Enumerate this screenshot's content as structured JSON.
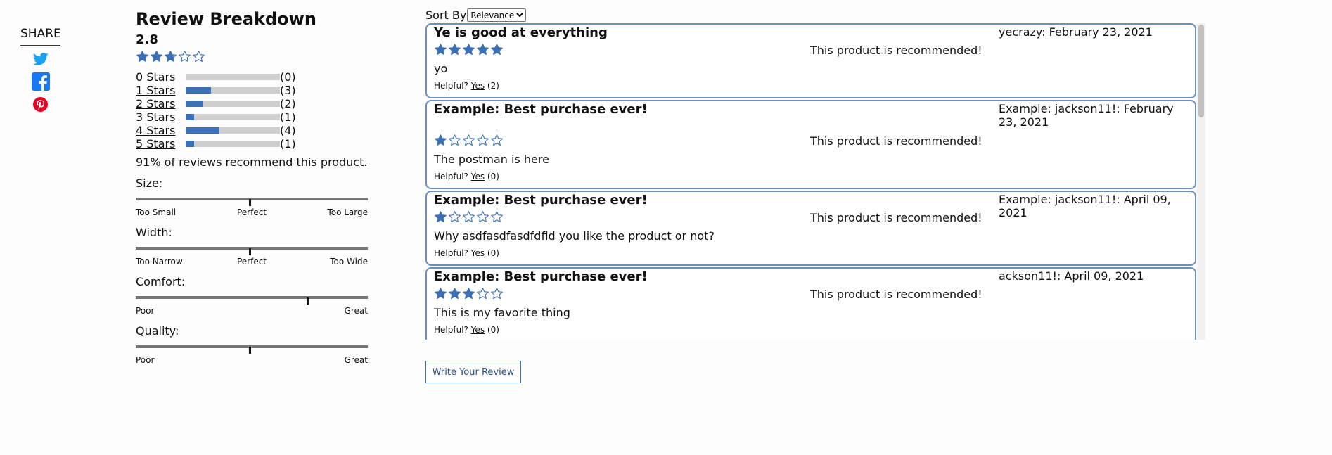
{
  "share": {
    "label": "SHARE",
    "icons": [
      "twitter-icon",
      "facebook-icon",
      "pinterest-icon"
    ],
    "colors": {
      "twitter": "#1da1f2",
      "facebook": "#1877f2",
      "pinterest": "#e60023"
    }
  },
  "breakdown": {
    "title": "Review Breakdown",
    "average": "2.8",
    "average_rating": 2.8,
    "distribution": [
      {
        "label": "0 Stars",
        "count": "(0)",
        "fraction": 0.0
      },
      {
        "label": "1 Stars",
        "count": "(3)",
        "fraction": 0.27
      },
      {
        "label": "2 Stars",
        "count": "(2)",
        "fraction": 0.18
      },
      {
        "label": "3 Stars",
        "count": "(1)",
        "fraction": 0.09
      },
      {
        "label": "4 Stars",
        "count": "(4)",
        "fraction": 0.36
      },
      {
        "label": "5 Stars",
        "count": "(1)",
        "fraction": 0.09
      }
    ],
    "recommend_text": "91% of reviews recommend this product.",
    "characteristics": [
      {
        "name": "Size:",
        "value": 0.49,
        "labels": {
          "left": "Too Small",
          "middle": "Perfect",
          "right": "Too Large"
        }
      },
      {
        "name": "Width:",
        "value": 0.49,
        "labels": {
          "left": "Too Narrow",
          "middle": "Perfect",
          "right": "Too Wide"
        }
      },
      {
        "name": "Comfort:",
        "value": 0.74,
        "labels": {
          "left": "Poor",
          "right": "Great"
        }
      },
      {
        "name": "Quality:",
        "value": 0.49,
        "labels": {
          "left": "Poor",
          "right": "Great"
        }
      }
    ]
  },
  "sort": {
    "label": "Sort By",
    "selected": "Relevance"
  },
  "reviews": [
    {
      "title": "Ye is good at everything",
      "author": "yecrazy: February 23, 2021",
      "rating": 5,
      "recommend": "This product is recommended!",
      "body": "yo",
      "helpful_label": "Helpful?",
      "yes_label": "Yes",
      "helpful_count": "(2)"
    },
    {
      "title": "Example: Best purchase ever!",
      "author": "Example: jackson11!: February 23, 2021",
      "rating": 1,
      "recommend": "This product is recommended!",
      "body": "The postman is here",
      "helpful_label": "Helpful?",
      "yes_label": "Yes",
      "helpful_count": "(0)"
    },
    {
      "title": "Example: Best purchase ever!",
      "author": "Example: jackson11!: April 09, 2021",
      "rating": 1,
      "recommend": "This product is recommended!",
      "body": "Why asdfasdfasdfdfid you like the product or not?",
      "helpful_label": "Helpful?",
      "yes_label": "Yes",
      "helpful_count": "(0)"
    },
    {
      "title": "Example: Best purchase ever!",
      "author": "ackson11!: April 09, 2021",
      "rating": 3,
      "recommend": "This product is recommended!",
      "body": "This is my favorite thing",
      "helpful_label": "Helpful?",
      "yes_label": "Yes",
      "helpful_count": "(0)"
    }
  ],
  "write_review_label": "Write Your Review",
  "colors": {
    "accent": "#3b6fb6",
    "card_border": "#6a8fc0",
    "bar_bg": "#cfcfcf"
  }
}
